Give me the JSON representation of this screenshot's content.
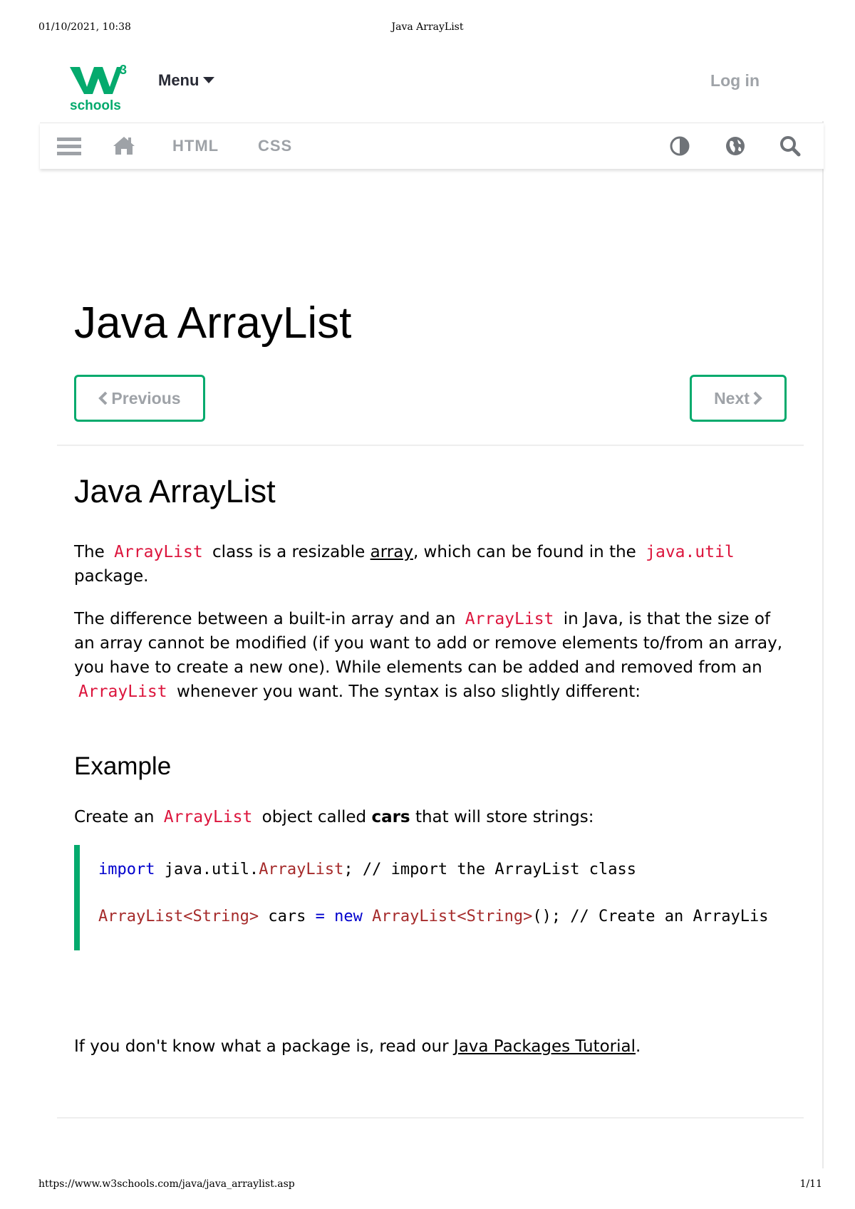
{
  "print": {
    "date": "01/10/2021, 10:38",
    "title": "Java ArrayList",
    "url": "https://www.w3schools.com/java/java_arraylist.asp",
    "page": "1/11"
  },
  "colors": {
    "brand": "#04aa6d",
    "code_inline": "#dc143c",
    "keyword": "#0000cd",
    "type": "#a52a2a",
    "muted": "#9ea2a7"
  },
  "topbar": {
    "logo_text": "schools",
    "logo_sup": "3",
    "menu_label": "Menu",
    "login_label": "Log in"
  },
  "navbar": {
    "links": [
      "HTML",
      "CSS"
    ],
    "icons": [
      "hamburger-icon",
      "home-icon",
      "contrast-icon",
      "globe-icon",
      "search-icon"
    ]
  },
  "main": {
    "title": "Java ArrayList",
    "prev_label": "Previous",
    "next_label": "Next",
    "section_title": "Java ArrayList",
    "p1": {
      "t1": "The",
      "c1": "ArrayList",
      "t2": "class is a resizable",
      "link": "array",
      "t3": ", which can be found in the",
      "c2": "java.util",
      "t4": "package."
    },
    "p2": {
      "t1": "The difference between a built-in array and an",
      "c1": "ArrayList",
      "t2": "in Java, is that the size of an array cannot be modified (if you want to add or remove elements to/from an array, you have to create a new one). While elements can be added and removed from an",
      "c2": "ArrayList",
      "t3": "whenever you want. The syntax is also slightly different:"
    },
    "example_title": "Example",
    "example_desc": {
      "t1": "Create an",
      "c1": "ArrayList",
      "t2": "object called",
      "bold": "cars",
      "t3": "that will store strings:"
    },
    "code": {
      "line1": {
        "kw": "import",
        "rest1": " java.util.",
        "ty": "ArrayList",
        "rest2": "; // import the ArrayList class"
      },
      "line2": {
        "ty1": "ArrayList<String>",
        "rest1": " cars ",
        "op": "=",
        "sp": " ",
        "kw": "new",
        "sp2": " ",
        "ty2": "ArrayList<String>",
        "rest2": "(); // Create an ArrayLis"
      }
    },
    "p3": {
      "t1": "If you don't know what a package is, read our",
      "link": "Java Packages Tutorial",
      "t2": "."
    }
  }
}
